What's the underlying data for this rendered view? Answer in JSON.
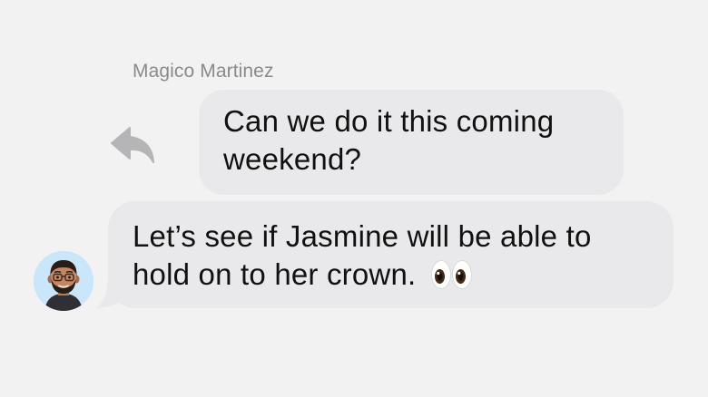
{
  "conversation": {
    "sender_name": "Magico Martinez",
    "quoted_message": {
      "text": "Can we do it this coming weekend?"
    },
    "reply_message": {
      "text": "Let’s see if Jasmine will be able to hold on to her crown.",
      "emoji": "eyes-emoji"
    },
    "reply_indicator_icon": "reply-arrow-icon",
    "avatar_icon": "memoji-avatar"
  },
  "colors": {
    "background": "#f2f2f2",
    "bubble": "#e9e9eb",
    "text": "#111111",
    "sender_name": "#8a8a8e",
    "reply_icon": "#b5b5b8",
    "avatar_bg": "#c9e6fa"
  }
}
